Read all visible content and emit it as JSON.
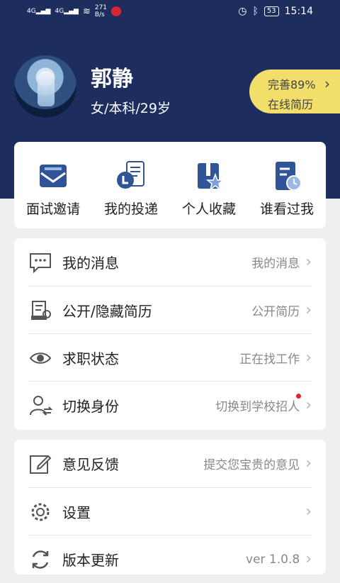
{
  "status_bar": {
    "network_type_1": "4G",
    "network_type_2": "4G",
    "data_rate_value": "271",
    "data_rate_unit": "B/s",
    "battery": "53",
    "time": "15:14"
  },
  "profile": {
    "name": "郭静",
    "meta": "女/本科/29岁",
    "resume_completion": "完善89%",
    "resume_label": "在线简历"
  },
  "quick_actions": [
    {
      "label": "面试邀请",
      "icon": "mail-icon"
    },
    {
      "label": "我的投递",
      "icon": "resume-send-icon"
    },
    {
      "label": "个人收藏",
      "icon": "bookmark-star-icon"
    },
    {
      "label": "谁看过我",
      "icon": "document-clock-icon"
    }
  ],
  "menu_group_1": [
    {
      "label": "我的消息",
      "value": "我的消息",
      "icon": "message-icon"
    },
    {
      "label": "公开/隐藏简历",
      "value": "公开简历",
      "icon": "resume-visibility-icon"
    },
    {
      "label": "求职状态",
      "value": "正在找工作",
      "icon": "status-eye-icon"
    },
    {
      "label": "切换身份",
      "value": "切换到学校招人",
      "icon": "switch-user-icon",
      "has_notification": true
    }
  ],
  "menu_group_2": [
    {
      "label": "意见反馈",
      "value": "提交您宝贵的意见",
      "icon": "edit-icon"
    },
    {
      "label": "设置",
      "value": "",
      "icon": "gear-icon"
    },
    {
      "label": "版本更新",
      "value": "ver 1.0.8",
      "icon": "refresh-icon"
    }
  ],
  "colors": {
    "header_bg": "#1c2d5e",
    "badge_bg": "#f2de6a",
    "icon_blue": "#2f5597",
    "notification_dot": "#e0262d"
  }
}
